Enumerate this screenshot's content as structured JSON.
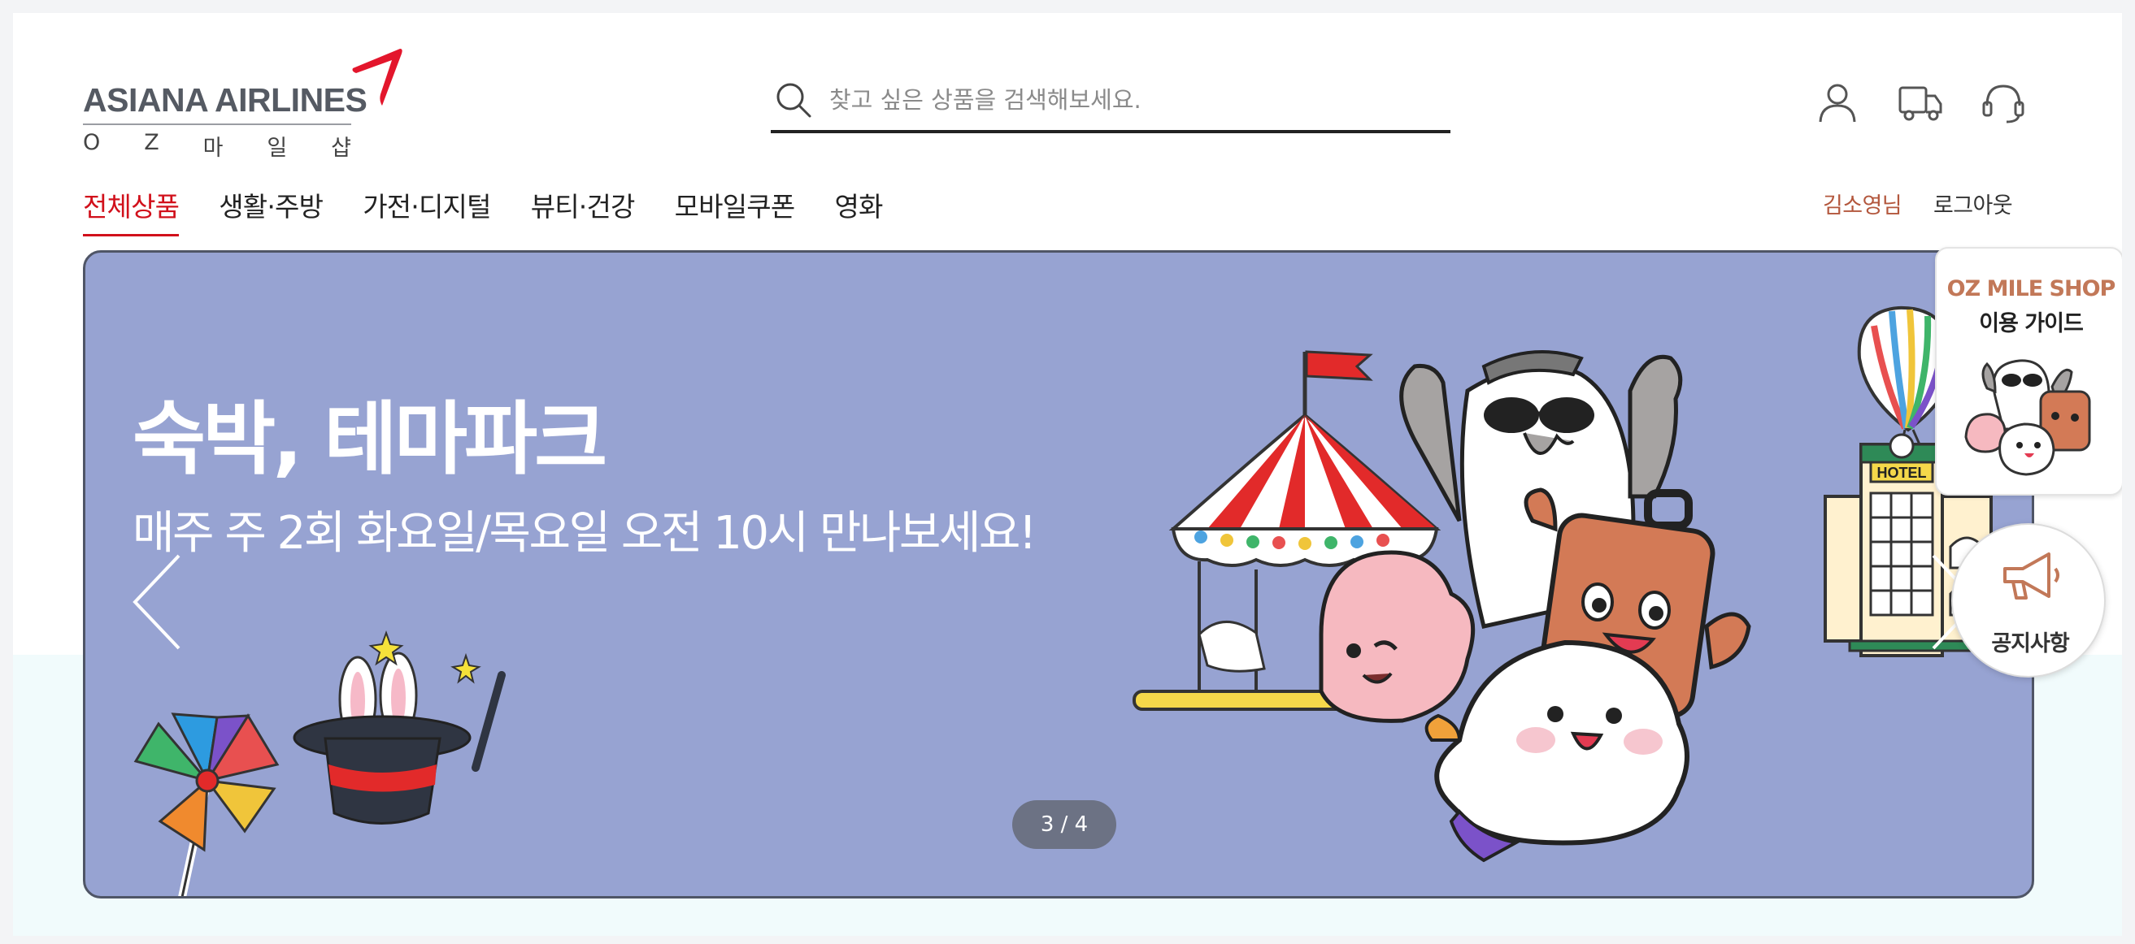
{
  "logo": {
    "brand": "ASIANA AIRLINES",
    "sub_letters": [
      "O",
      "Z",
      "마",
      "일",
      "샵"
    ]
  },
  "search": {
    "placeholder": "찾고 싶은 상품을 검색해보세요.",
    "value": ""
  },
  "header_icons": [
    "user-icon",
    "delivery-truck-icon",
    "headset-icon"
  ],
  "nav": {
    "items": [
      {
        "label": "전체상품",
        "active": true
      },
      {
        "label": "생활·주방",
        "active": false
      },
      {
        "label": "가전·디지털",
        "active": false
      },
      {
        "label": "뷰티·건강",
        "active": false
      },
      {
        "label": "모바일쿠폰",
        "active": false
      },
      {
        "label": "영화",
        "active": false
      }
    ],
    "user_name": "김소영님",
    "logout_label": "로그아웃"
  },
  "banner": {
    "title": "숙박, 테마파크",
    "subtitle": "매주 주 2회 화요일/목요일 오전 10시 만나보세요!",
    "counter": "3 / 4",
    "hotel_sign": "HOTEL",
    "background_color": "#97a3d2"
  },
  "side": {
    "guide_title": "OZ MILE SHOP",
    "guide_sub": "이용 가이드",
    "notice_label": "공지사항"
  },
  "colors": {
    "accent_red": "#d1101b",
    "user_name": "#b3573d",
    "guide_brown": "#c27858"
  }
}
